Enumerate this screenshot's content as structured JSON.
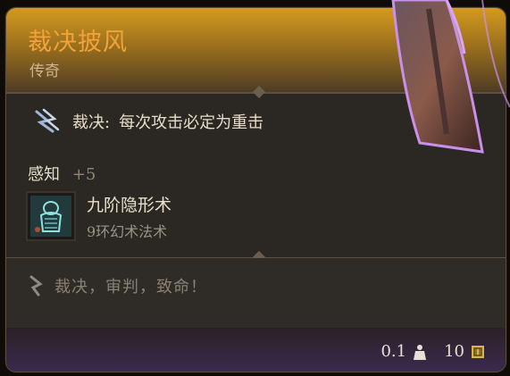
{
  "item": {
    "name": "裁决披风",
    "rarity": "传奇",
    "rarity_color": "#f0a33a"
  },
  "passive": {
    "icon": "lightning-claw-icon",
    "name": "裁决:",
    "description": "每次攻击必定为重击"
  },
  "stat": {
    "name": "感知",
    "value": "+5"
  },
  "spell": {
    "icon": "invisibility-spell-icon",
    "name": "九阶隐形术",
    "level": "9环幻术法术"
  },
  "flavor": {
    "icon": "quill-icon",
    "text": "裁决，审判，致命！"
  },
  "footer": {
    "weight": "0.1",
    "weight_icon": "weight-icon",
    "gold": "10",
    "gold_icon": "gold-coin-icon"
  }
}
